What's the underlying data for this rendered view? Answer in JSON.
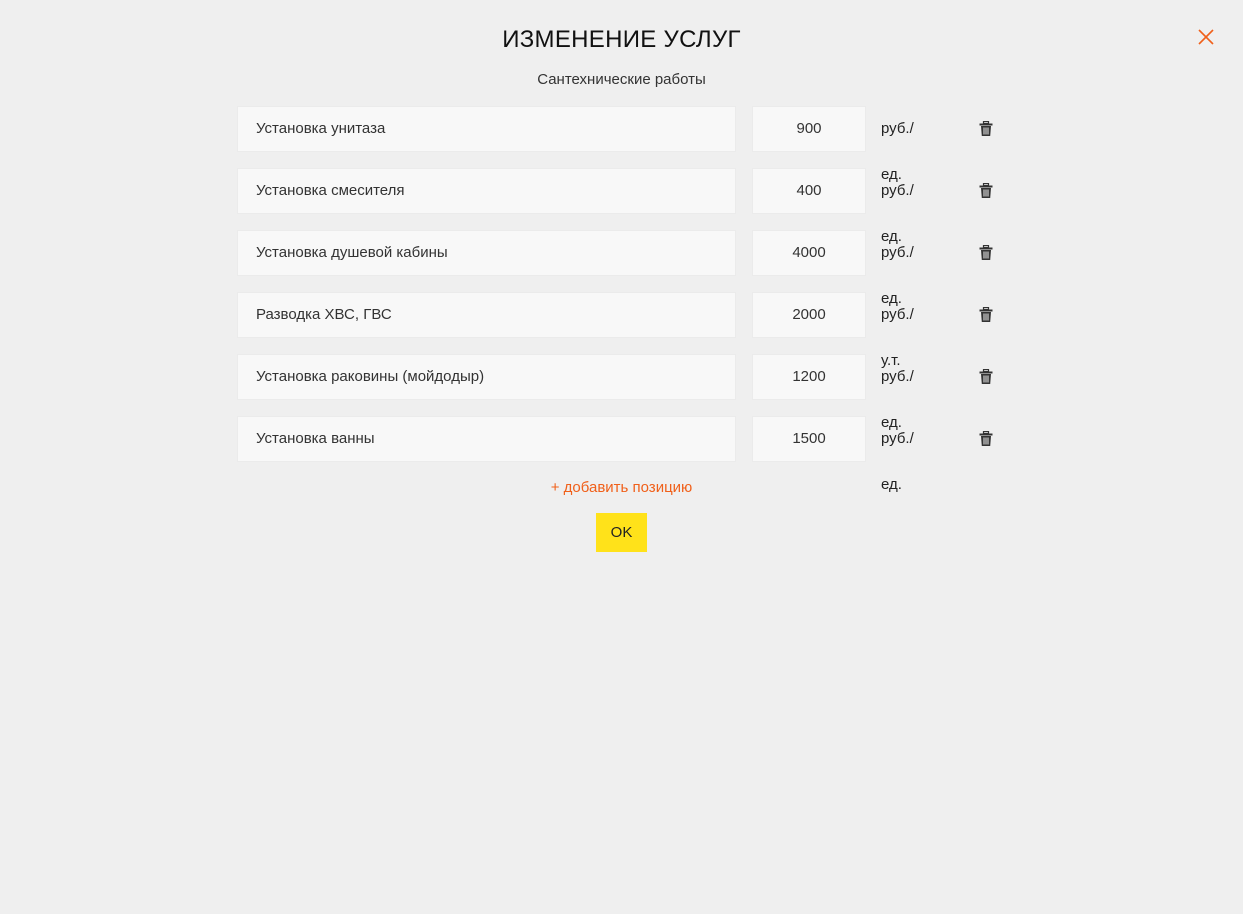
{
  "dialog": {
    "title": "ИЗМЕНЕНИЕ УСЛУГ",
    "subtitle": "Сантехнические работы",
    "close_icon": "close-icon",
    "accent_color": "#f0601a"
  },
  "services": [
    {
      "name": "Установка унитаза",
      "price": "900",
      "unit": "руб./ед."
    },
    {
      "name": "Установка смесителя",
      "price": "400",
      "unit": "руб./ед."
    },
    {
      "name": "Установка душевой кабины",
      "price": "4000",
      "unit": "руб./ед."
    },
    {
      "name": "Разводка ХВС, ГВС",
      "price": "2000",
      "unit": "руб./у.т."
    },
    {
      "name": "Установка раковины (мойдодыр)",
      "price": "1200",
      "unit": "руб./ед."
    },
    {
      "name": "Установка ванны",
      "price": "1500",
      "unit": "руб./ед."
    }
  ],
  "row_delete_icon": "trash-icon",
  "actions": {
    "add_label": "+ добавить позицию",
    "ok_label": "OK",
    "ok_color": "#ffe21a"
  }
}
